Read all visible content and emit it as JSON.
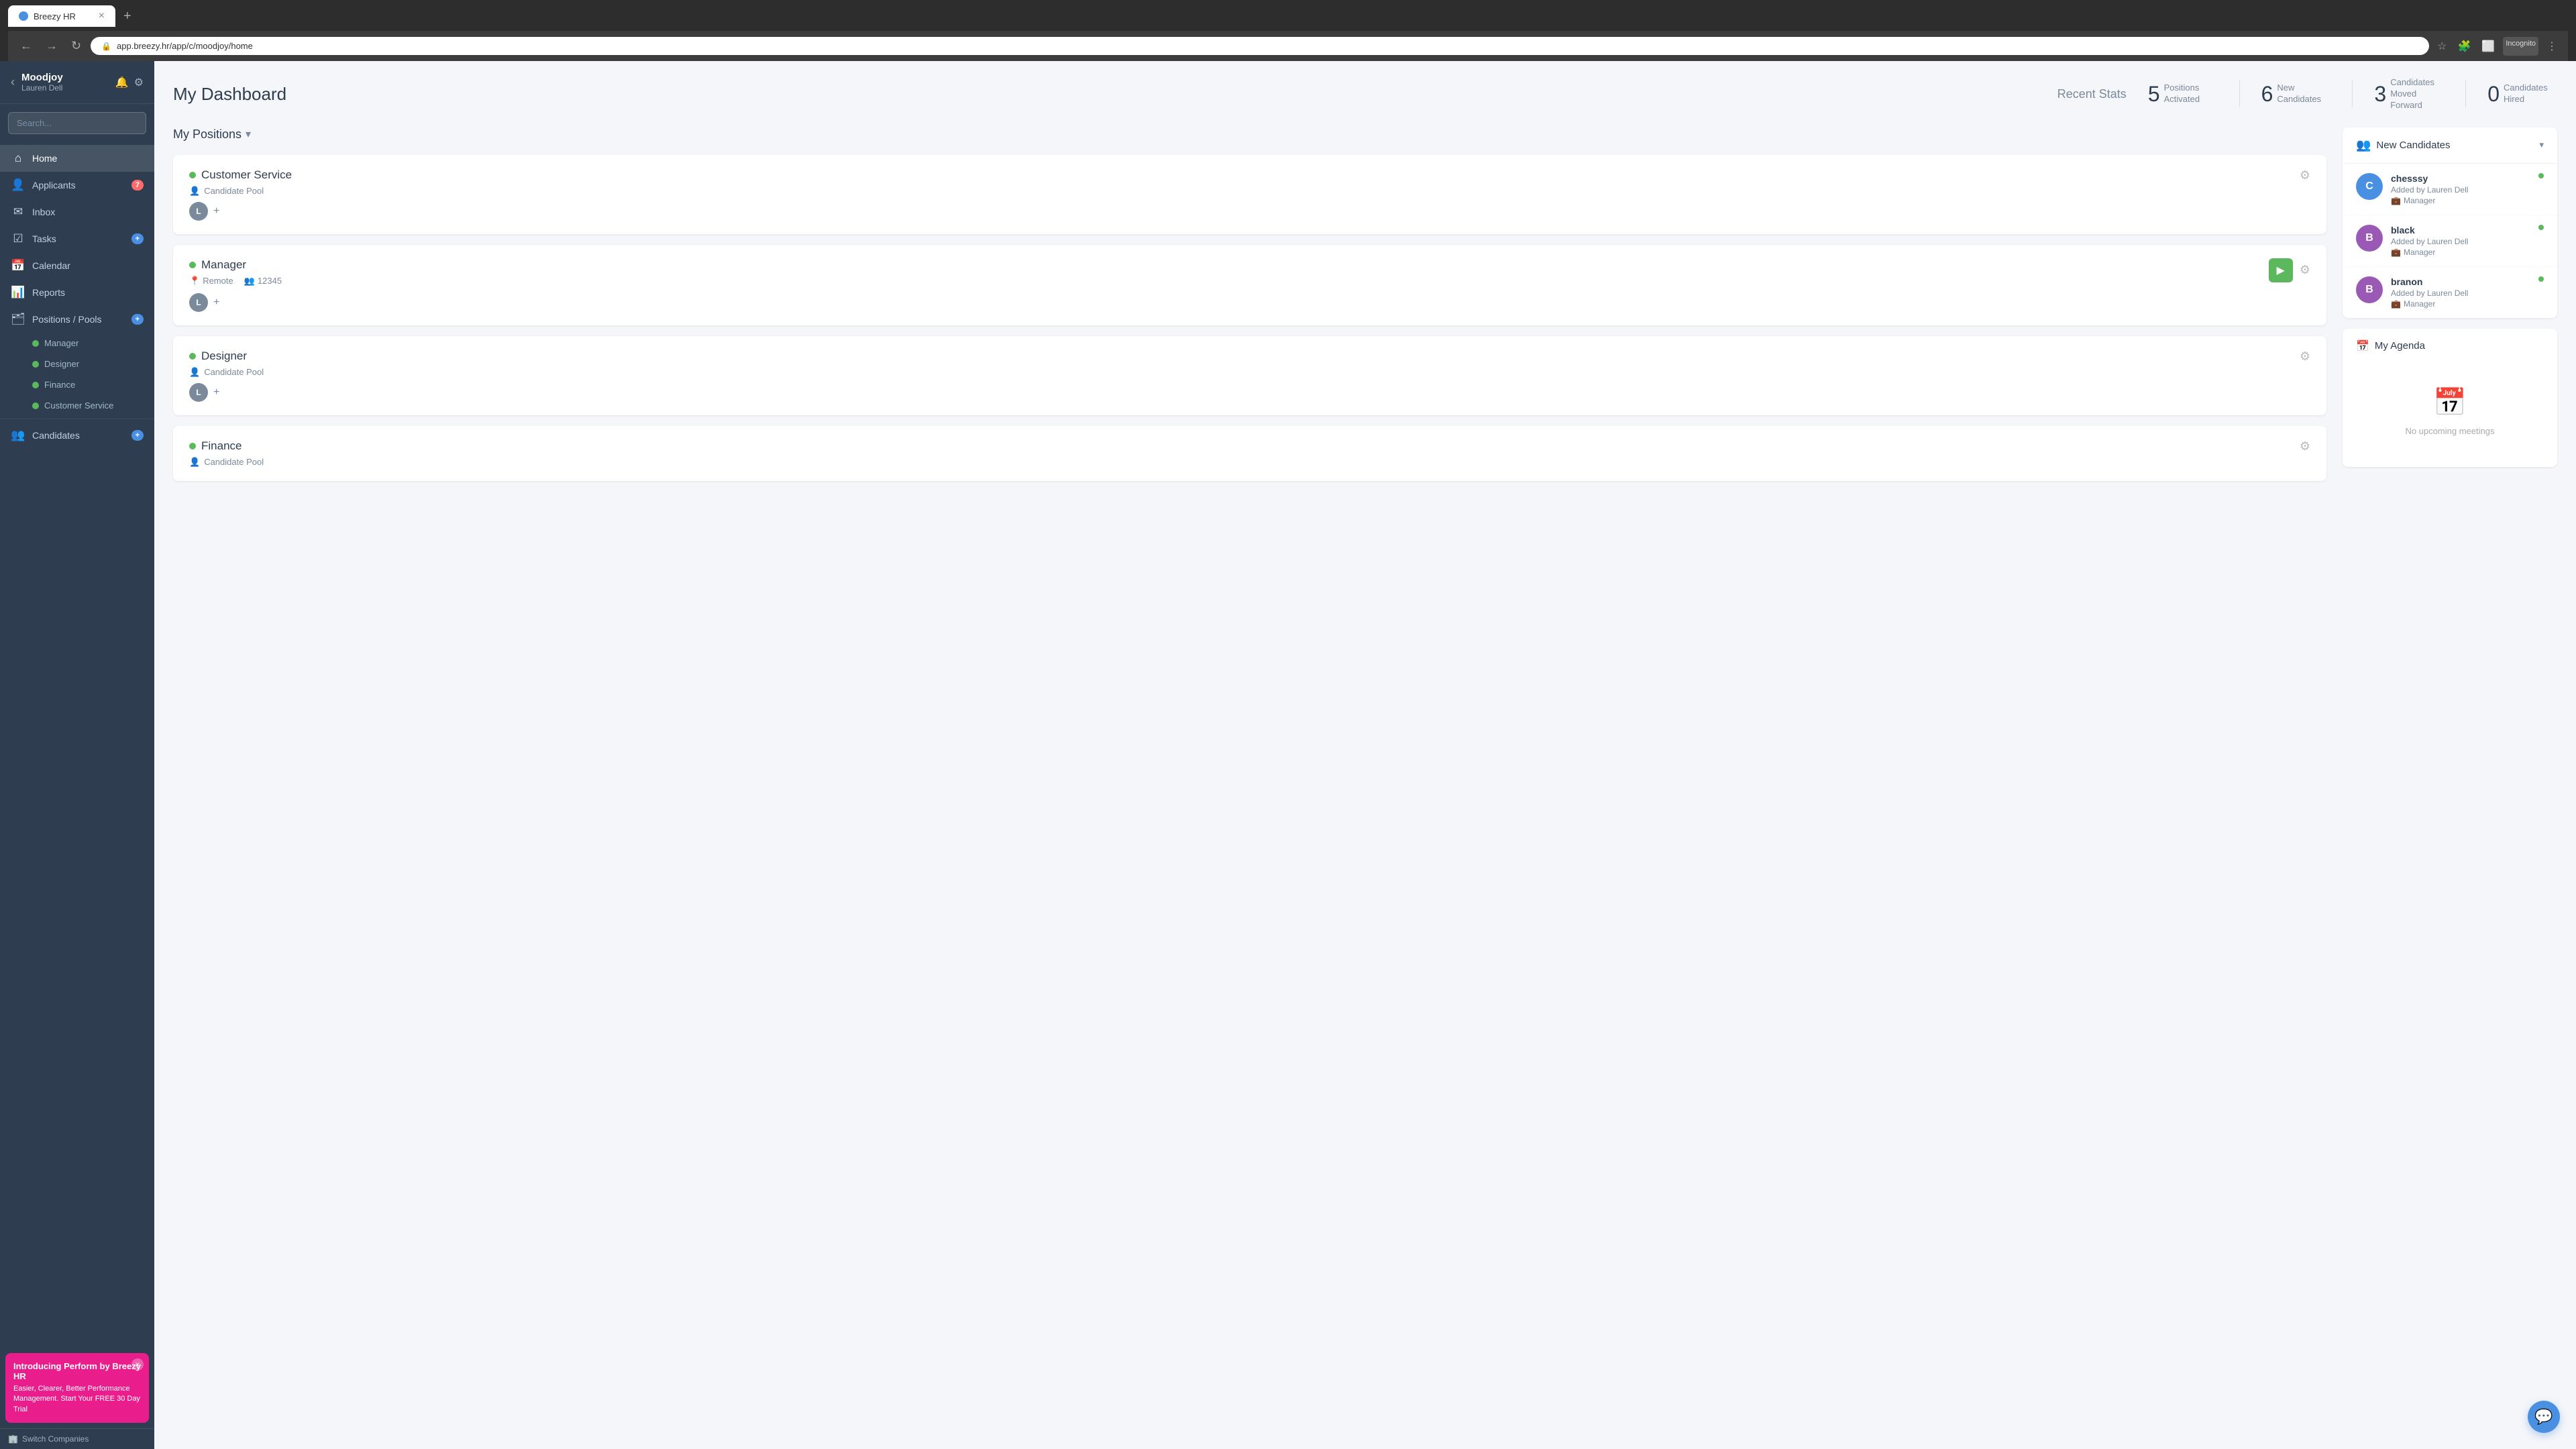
{
  "browser": {
    "tab_label": "Breezy HR",
    "tab_close": "×",
    "tab_new": "+",
    "url": "app.breezy.hr/app/c/moodjoy/home",
    "nav_back": "←",
    "nav_forward": "→",
    "nav_refresh": "↻",
    "incognito_label": "Incognito"
  },
  "sidebar": {
    "collapse_icon": "‹",
    "company_name": "Moodjoy",
    "user_name": "Lauren Dell",
    "bell_icon": "🔔",
    "settings_icon": "⚙",
    "search_placeholder": "Search...",
    "nav_items": [
      {
        "id": "home",
        "icon": "⌂",
        "label": "Home",
        "badge": null
      },
      {
        "id": "applicants",
        "icon": "👤",
        "label": "Applicants",
        "badge": "7",
        "badge_color": "red"
      },
      {
        "id": "inbox",
        "icon": "✉",
        "label": "Inbox",
        "badge": null
      },
      {
        "id": "tasks",
        "icon": "☑",
        "label": "Tasks",
        "badge": "+",
        "badge_color": "blue"
      },
      {
        "id": "calendar",
        "icon": "📅",
        "label": "Calendar",
        "badge": null
      },
      {
        "id": "reports",
        "icon": "📊",
        "label": "Reports",
        "badge": null
      },
      {
        "id": "positions",
        "icon": "🗂",
        "label": "Positions / Pools",
        "badge": "+",
        "badge_color": "blue"
      }
    ],
    "sub_items": [
      {
        "label": "Manager"
      },
      {
        "label": "Designer"
      },
      {
        "label": "Finance"
      },
      {
        "label": "Customer Service"
      }
    ],
    "candidates_label": "Candidates",
    "candidates_badge": "+",
    "promo": {
      "title": "Introducing Perform by Breezy HR",
      "text": "Easier, Clearer, Better Performance Management. Start Your FREE 30 Day Trial",
      "close": "×"
    },
    "switch_label": "Switch Companies"
  },
  "dashboard": {
    "title": "My Dashboard",
    "stats_label": "Recent Stats",
    "stats": [
      {
        "number": "5",
        "desc": "Positions Activated"
      },
      {
        "number": "6",
        "desc": "New Candidates"
      },
      {
        "number": "3",
        "desc": "Candidates Moved Forward"
      },
      {
        "number": "0",
        "desc": "Candidates Hired"
      }
    ]
  },
  "positions": {
    "section_title": "My Positions",
    "dropdown_arrow": "▾",
    "items": [
      {
        "id": "customer-service",
        "name": "Customer Service",
        "pool": "Candidate Pool",
        "meta": []
      },
      {
        "id": "manager",
        "name": "Manager",
        "pool": null,
        "meta": [
          {
            "icon": "📍",
            "text": "Remote"
          },
          {
            "icon": "👥",
            "text": "12345"
          }
        ],
        "has_video": true
      },
      {
        "id": "designer",
        "name": "Designer",
        "pool": "Candidate Pool",
        "meta": []
      },
      {
        "id": "finance",
        "name": "Finance",
        "pool": "Candidate Pool",
        "meta": []
      }
    ]
  },
  "new_candidates": {
    "title": "New Candidates",
    "dropdown": "▾",
    "items": [
      {
        "name": "chesssy",
        "added_by": "Added by Lauren Dell",
        "position": "Manager",
        "avatar_letter": "C",
        "avatar_color": "#4a90e2"
      },
      {
        "name": "black",
        "added_by": "Added by Lauren Dell",
        "position": "Manager",
        "avatar_letter": "B",
        "avatar_color": "#9b59b6"
      },
      {
        "name": "branon",
        "added_by": "Added by Lauren Dell",
        "position": "Manager",
        "avatar_letter": "B",
        "avatar_color": "#9b59b6"
      }
    ]
  },
  "agenda": {
    "title": "My Agenda",
    "icon": "📅",
    "empty_text": "No upcoming meetings"
  },
  "icons": {
    "gear": "⚙",
    "person": "👤",
    "location": "📍",
    "group": "👥",
    "video": "▶",
    "new_badge_color": "#5cb85c",
    "calendar": "📅",
    "briefcase": "💼",
    "chat": "💬"
  }
}
